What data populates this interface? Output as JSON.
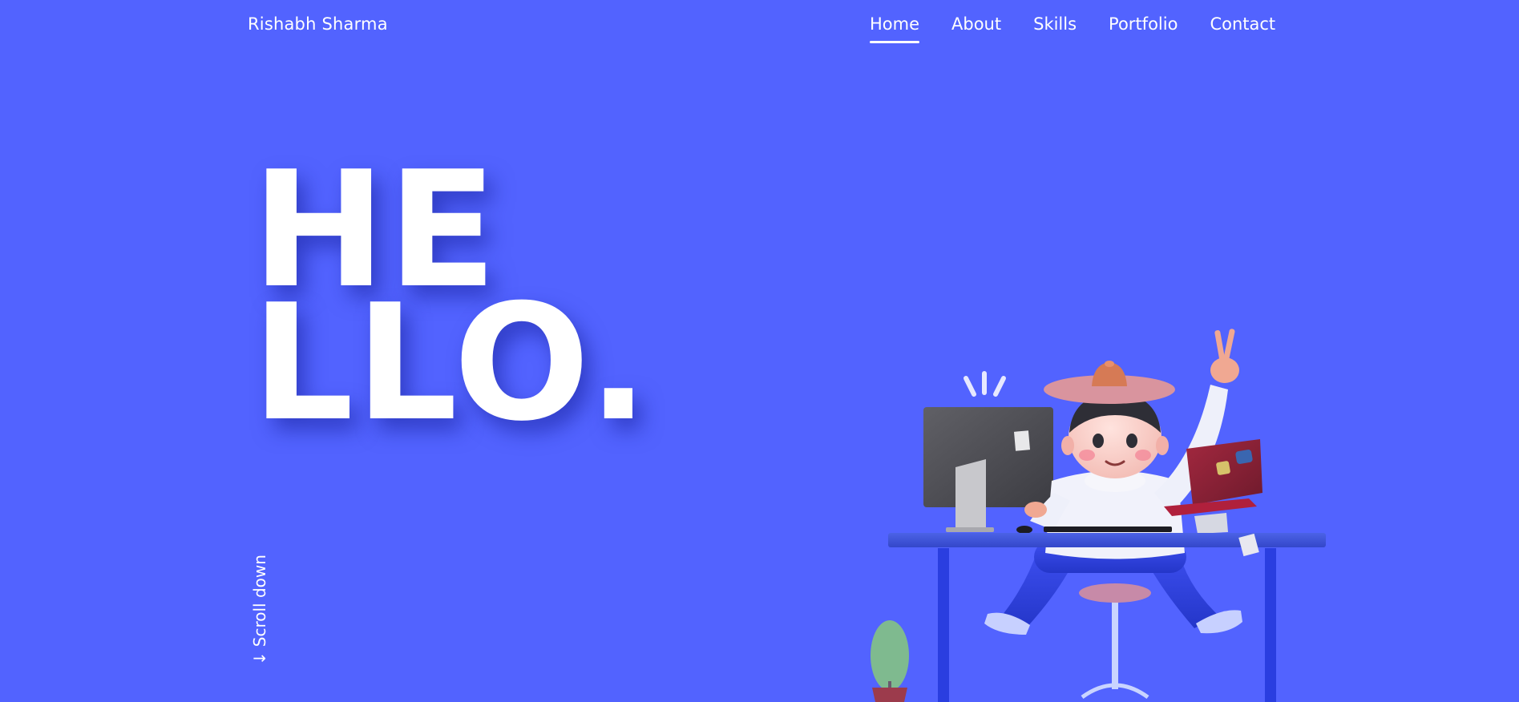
{
  "header": {
    "brand": "Rishabh Sharma",
    "nav": [
      {
        "label": "Home",
        "active": true
      },
      {
        "label": "About",
        "active": false
      },
      {
        "label": "Skills",
        "active": false
      },
      {
        "label": "Portfolio",
        "active": false
      },
      {
        "label": "Contact",
        "active": false
      }
    ]
  },
  "hero": {
    "line1": "HE",
    "line2": "LLO."
  },
  "scroll": {
    "label": "Scroll down",
    "icon": "arrow-down-icon"
  },
  "colors": {
    "background": "#5263ff",
    "text": "#ffffff"
  }
}
